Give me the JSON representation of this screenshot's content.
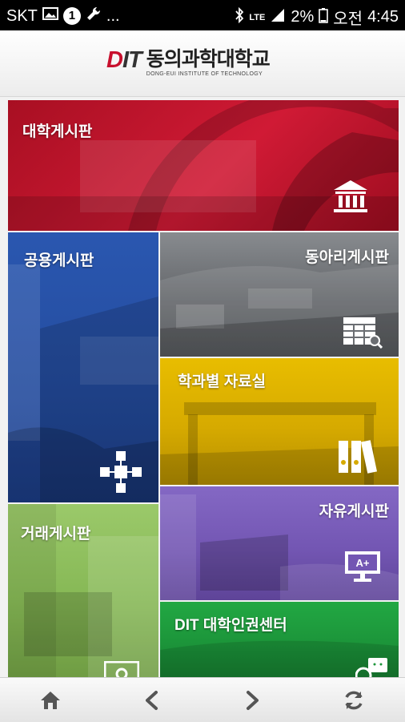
{
  "status_bar": {
    "carrier": "SKT",
    "notification_count": "1",
    "ellipsis": "...",
    "network": "LTE",
    "battery": "2%",
    "ampm": "오전",
    "time": "4:45"
  },
  "header": {
    "logo_mark_d": "D",
    "logo_mark_it": "IT",
    "logo_korean": "동의과학대학교",
    "logo_english": "DONG-EUI INSTITUTE OF TECHNOLOGY"
  },
  "tiles": [
    {
      "label": "대학게시판",
      "icon": "building-icon",
      "color": "#c8102e"
    },
    {
      "label": "공용게시판",
      "icon": "network-icon",
      "color": "#2f5fb3"
    },
    {
      "label": "동아리게시판",
      "icon": "table-search-icon",
      "color": "#6b6e72"
    },
    {
      "label": "학과별 자료실",
      "icon": "binders-icon",
      "color": "#e0b400"
    },
    {
      "label": "자유게시판",
      "icon": "monitor-grade-icon",
      "color": "#7a5bb8"
    },
    {
      "label": "거래게시판",
      "icon": "card-icon",
      "color": "#8cbf5a"
    },
    {
      "label": "DIT 대학인권센터",
      "icon": "chat-icon",
      "color": "#1f9e3c"
    }
  ],
  "bottom_nav": [
    "home-icon",
    "back-arrow-icon",
    "forward-arrow-icon",
    "refresh-icon"
  ]
}
